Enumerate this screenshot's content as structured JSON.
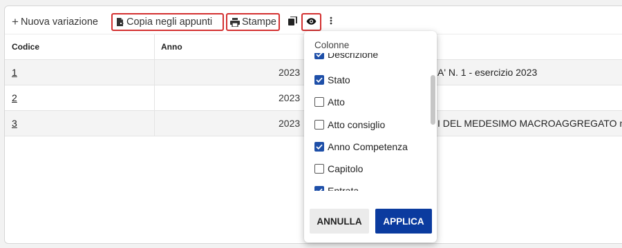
{
  "toolbar": {
    "new_variation_label": "Nuova variazione",
    "copy_clipboard_label": "Copia negli appunti",
    "print_label": "Stampe"
  },
  "table": {
    "headers": {
      "code": "Codice",
      "year": "Anno"
    },
    "rows": [
      {
        "code": "1",
        "year": "2023",
        "description": "A' N. 1 - esercizio 2023"
      },
      {
        "code": "2",
        "year": "2023",
        "description": ""
      },
      {
        "code": "3",
        "year": "2023",
        "description": "I DEL MEDESIMO MACROAGGREGATO n"
      }
    ]
  },
  "columns_menu": {
    "title": "Colonne",
    "items": [
      {
        "label": "Descrizione",
        "checked": true
      },
      {
        "label": "Stato",
        "checked": true
      },
      {
        "label": "Atto",
        "checked": false
      },
      {
        "label": "Atto consiglio",
        "checked": false
      },
      {
        "label": "Anno Competenza",
        "checked": true
      },
      {
        "label": "Capitolo",
        "checked": false
      },
      {
        "label": "Entrata",
        "checked": true
      }
    ],
    "cancel_label": "ANNULLA",
    "apply_label": "APPLICA"
  },
  "colors": {
    "highlight_outline": "#d32f2f",
    "primary": "#0b3b9f",
    "checkbox_checked": "#1e4fa8"
  }
}
